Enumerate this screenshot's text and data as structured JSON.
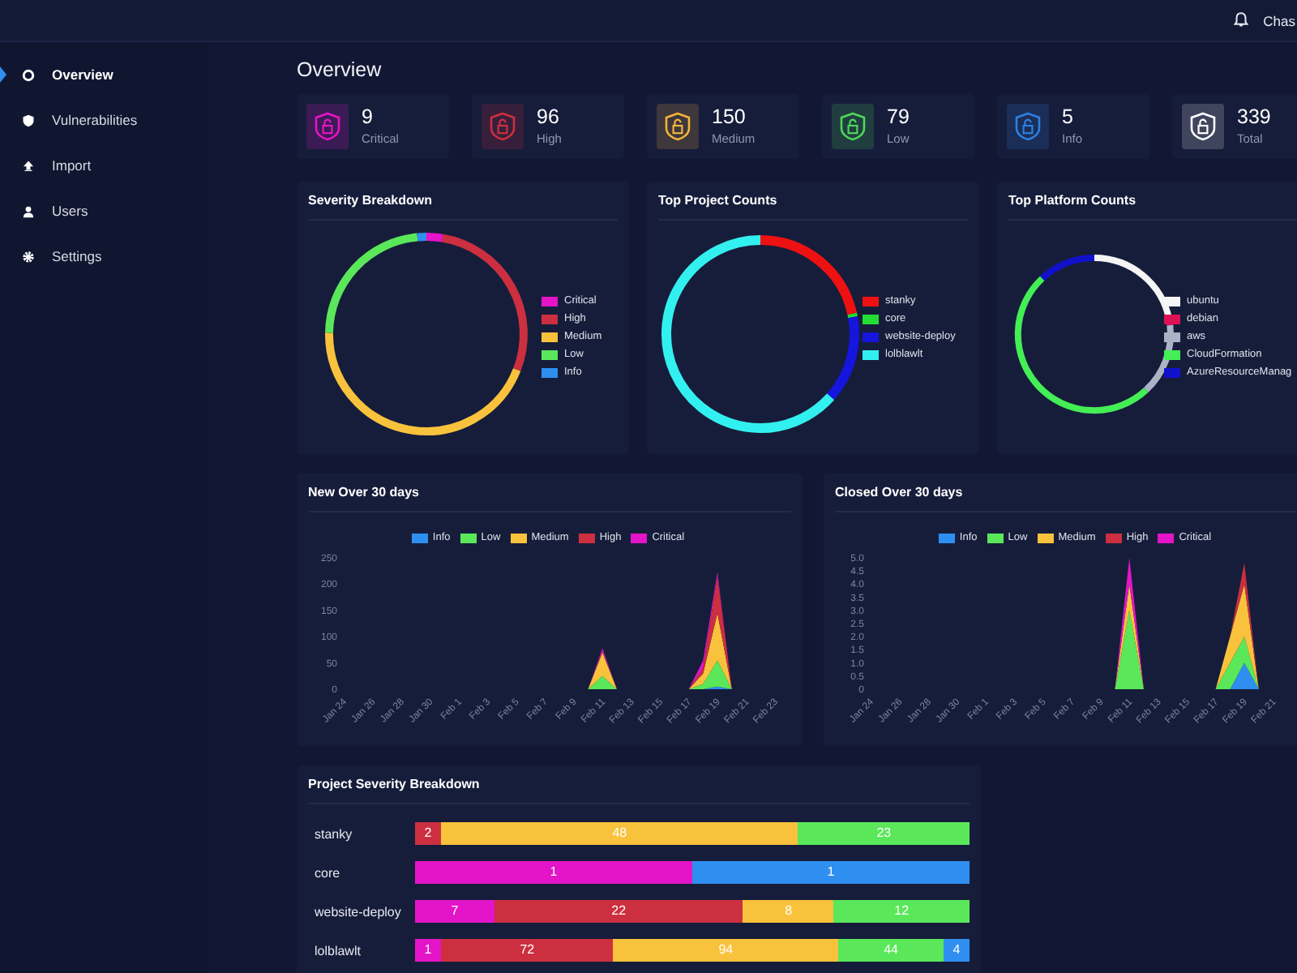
{
  "topbar": {
    "user": "Chas"
  },
  "sidebar": {
    "items": [
      {
        "label": "Overview",
        "selected": true
      },
      {
        "label": "Vulnerabilities",
        "selected": false
      },
      {
        "label": "Import",
        "selected": false
      },
      {
        "label": "Users",
        "selected": false
      },
      {
        "label": "Settings",
        "selected": false
      }
    ]
  },
  "page_title": "Overview",
  "stats": [
    {
      "value": "9",
      "label": "Critical",
      "color": "#e414c8"
    },
    {
      "value": "96",
      "label": "High",
      "color": "#cc2f3f"
    },
    {
      "value": "150",
      "label": "Medium",
      "color": "#f2b33d"
    },
    {
      "value": "79",
      "label": "Low",
      "color": "#4fd65a"
    },
    {
      "value": "5",
      "label": "Info",
      "color": "#2f7fe0"
    },
    {
      "value": "339",
      "label": "Total",
      "color": "#ffffff"
    }
  ],
  "donut_panels": [
    {
      "title": "Severity Breakdown",
      "legend": [
        {
          "label": "Critical",
          "color": "#e414c8"
        },
        {
          "label": "High",
          "color": "#cc2f3f"
        },
        {
          "label": "Medium",
          "color": "#f9c23c"
        },
        {
          "label": "Low",
          "color": "#5ae85a"
        },
        {
          "label": "Info",
          "color": "#2f8ff0"
        }
      ]
    },
    {
      "title": "Top Project Counts",
      "legend": [
        {
          "label": "stanky",
          "color": "#ee1111"
        },
        {
          "label": "core",
          "color": "#22dd33"
        },
        {
          "label": "website-deploy",
          "color": "#1515dd"
        },
        {
          "label": "lolblawlt",
          "color": "#33f0f0"
        }
      ]
    },
    {
      "title": "Top Platform Counts",
      "legend": [
        {
          "label": "ubuntu",
          "color": "#f5f5f5"
        },
        {
          "label": "debian",
          "color": "#dd1155"
        },
        {
          "label": "aws",
          "color": "#aab4c6"
        },
        {
          "label": "CloudFormation",
          "color": "#44ee55"
        },
        {
          "label": "AzureResourceManag",
          "color": "#1111cc"
        }
      ]
    }
  ],
  "trend_panels": [
    {
      "chart_data": {
        "type": "area",
        "title": "New Over 30 days",
        "stacked": true,
        "legend": "top",
        "categories": [
          "Jan 24",
          null,
          "Jan 26",
          null,
          "Jan 28",
          null,
          "Jan 30",
          null,
          "Feb 1",
          null,
          "Feb 3",
          null,
          "Feb 5",
          null,
          "Feb 7",
          null,
          "Feb 9",
          null,
          "Feb 11",
          null,
          "Feb 13",
          null,
          "Feb 15",
          null,
          "Feb 17",
          null,
          "Feb 19",
          null,
          "Feb 21",
          null,
          "Feb 23"
        ],
        "ylim": [
          0,
          250
        ],
        "yticks": [
          0,
          50,
          100,
          150,
          200,
          250
        ],
        "series": [
          {
            "name": "Info",
            "color": "#2f8ff0",
            "values": [
              0,
              0,
              0,
              0,
              0,
              0,
              0,
              0,
              0,
              0,
              0,
              0,
              0,
              0,
              0,
              0,
              0,
              0,
              0,
              0,
              0,
              0,
              0,
              0,
              0,
              0,
              5,
              0,
              0,
              0,
              0
            ]
          },
          {
            "name": "Low",
            "color": "#5ae85a",
            "values": [
              0,
              0,
              0,
              0,
              0,
              0,
              0,
              0,
              0,
              0,
              0,
              0,
              0,
              0,
              0,
              0,
              0,
              0,
              25,
              0,
              0,
              0,
              0,
              0,
              0,
              10,
              50,
              0,
              0,
              0,
              0
            ]
          },
          {
            "name": "Medium",
            "color": "#f9c23c",
            "values": [
              0,
              0,
              0,
              0,
              0,
              0,
              0,
              0,
              0,
              0,
              0,
              0,
              0,
              0,
              0,
              0,
              0,
              0,
              45,
              0,
              0,
              0,
              0,
              0,
              0,
              20,
              90,
              0,
              0,
              0,
              0
            ]
          },
          {
            "name": "High",
            "color": "#cc2f3f",
            "values": [
              0,
              0,
              0,
              0,
              0,
              0,
              0,
              0,
              0,
              0,
              0,
              0,
              0,
              0,
              0,
              0,
              0,
              0,
              3,
              0,
              0,
              0,
              0,
              0,
              0,
              10,
              70,
              0,
              0,
              0,
              0
            ]
          },
          {
            "name": "Critical",
            "color": "#e414c8",
            "values": [
              0,
              0,
              0,
              0,
              0,
              0,
              0,
              0,
              0,
              0,
              0,
              0,
              0,
              0,
              0,
              0,
              0,
              0,
              5,
              0,
              0,
              0,
              0,
              0,
              0,
              15,
              8,
              0,
              0,
              0,
              0
            ]
          }
        ]
      }
    },
    {
      "chart_data": {
        "type": "area",
        "title": "Closed Over 30 days",
        "stacked": true,
        "legend": "top",
        "categories": [
          "Jan 24",
          null,
          "Jan 26",
          null,
          "Jan 28",
          null,
          "Jan 30",
          null,
          "Feb 1",
          null,
          "Feb 3",
          null,
          "Feb 5",
          null,
          "Feb 7",
          null,
          "Feb 9",
          null,
          "Feb 11",
          null,
          "Feb 13",
          null,
          "Feb 15",
          null,
          "Feb 17",
          null,
          "Feb 19",
          null,
          "Feb 21",
          null,
          null
        ],
        "ylim": [
          0,
          5
        ],
        "yticks": [
          0,
          {
            "value": 0.5,
            "label": "0.5"
          },
          {
            "value": 1,
            "label": "1.0"
          },
          {
            "value": 1.5,
            "label": "1.5"
          },
          {
            "value": 2,
            "label": "2.0"
          },
          {
            "value": 2.5,
            "label": "2.5"
          },
          {
            "value": 3,
            "label": "3.0"
          },
          {
            "value": 3.5,
            "label": "3.5"
          },
          {
            "value": 4,
            "label": "4.0"
          },
          {
            "value": 4.5,
            "label": "4.5"
          },
          {
            "value": 5,
            "label": "5.0"
          }
        ],
        "series": [
          {
            "name": "Info",
            "color": "#2f8ff0",
            "values": [
              0,
              0,
              0,
              0,
              0,
              0,
              0,
              0,
              0,
              0,
              0,
              0,
              0,
              0,
              0,
              0,
              0,
              0,
              0,
              0,
              0,
              0,
              0,
              0,
              0,
              0,
              1,
              0,
              0,
              0,
              0
            ]
          },
          {
            "name": "Low",
            "color": "#5ae85a",
            "values": [
              0,
              0,
              0,
              0,
              0,
              0,
              0,
              0,
              0,
              0,
              0,
              0,
              0,
              0,
              0,
              0,
              0,
              0,
              3,
              0,
              0,
              0,
              0,
              0,
              0,
              1,
              1,
              0,
              0,
              0,
              0
            ]
          },
          {
            "name": "Medium",
            "color": "#f9c23c",
            "values": [
              0,
              0,
              0,
              0,
              0,
              0,
              0,
              0,
              0,
              0,
              0,
              0,
              0,
              0,
              0,
              0,
              0,
              0,
              1,
              0,
              0,
              0,
              0,
              0,
              0,
              1,
              2,
              0,
              0,
              0,
              0
            ]
          },
          {
            "name": "High",
            "color": "#cc2f3f",
            "values": [
              0,
              0,
              0,
              0,
              0,
              0,
              0,
              0,
              0,
              0,
              0,
              0,
              0,
              0,
              0,
              0,
              0,
              0,
              0,
              0,
              0,
              0,
              0,
              0,
              0,
              0,
              0.8,
              0,
              0,
              0,
              0
            ]
          },
          {
            "name": "Critical",
            "color": "#e414c8",
            "values": [
              0,
              0,
              0,
              0,
              0,
              0,
              0,
              0,
              0,
              0,
              0,
              0,
              0,
              0,
              0,
              0,
              0,
              0,
              1,
              0,
              0,
              0,
              0,
              0,
              0,
              0,
              0,
              0,
              0,
              0,
              0
            ]
          }
        ]
      }
    }
  ],
  "project_severity": {
    "title": "Project Severity Breakdown",
    "rows": [
      {
        "name": "stanky",
        "segments": [
          {
            "value": "2",
            "color": "#cc2f3f"
          },
          {
            "value": "48",
            "color": "#f9c23c"
          },
          {
            "value": "23",
            "color": "#5ae85a"
          }
        ]
      },
      {
        "name": "core",
        "segments": [
          {
            "value": "1",
            "color": "#e414c8"
          },
          {
            "value": "1",
            "color": "#2f8ff0"
          }
        ]
      },
      {
        "name": "website-deploy",
        "segments": [
          {
            "value": "7",
            "color": "#e414c8"
          },
          {
            "value": "22",
            "color": "#cc2f3f"
          },
          {
            "value": "8",
            "color": "#f9c23c"
          },
          {
            "value": "12",
            "color": "#5ae85a"
          }
        ]
      },
      {
        "name": "lolblawlt",
        "segments": [
          {
            "value": "1",
            "color": "#e414c8"
          },
          {
            "value": "72",
            "color": "#cc2f3f"
          },
          {
            "value": "94",
            "color": "#f9c23c"
          },
          {
            "value": "44",
            "color": "#5ae85a"
          },
          {
            "value": "4",
            "color": "#2f8ff0"
          }
        ]
      }
    ]
  }
}
